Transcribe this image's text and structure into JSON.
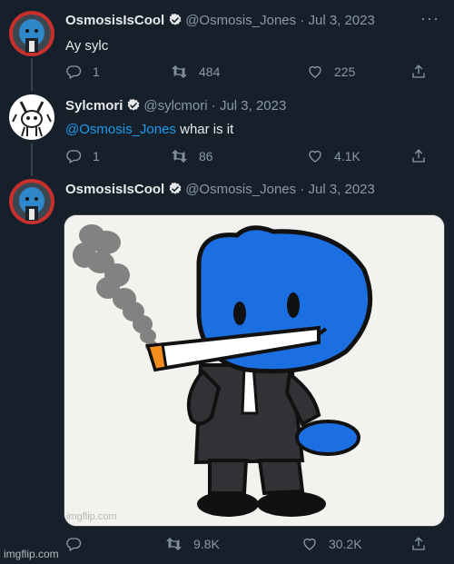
{
  "tweets": [
    {
      "display_name": "OsmosisIsCool",
      "handle": "@Osmosis_Jones",
      "date": "· Jul 3, 2023",
      "text": "Ay sylc",
      "replies": "1",
      "retweets": "484",
      "likes": "225"
    },
    {
      "display_name": "Sylcmori",
      "handle": "@sylcmori",
      "date": "· Jul 3, 2023",
      "mention": "@Osmosis_Jones",
      "text": " whar is it",
      "replies": "1",
      "retweets": "86",
      "likes": "4.1K"
    },
    {
      "display_name": "OsmosisIsCool",
      "handle": "@Osmosis_Jones",
      "date": "· Jul 3, 2023",
      "retweets": "9.8K",
      "likes": "30.2K",
      "media_watermark": "imgflip.com"
    }
  ],
  "more_icon": "···",
  "watermark": "imgflip.com",
  "colors": {
    "background": "#15202b",
    "text": "#e7e9ea",
    "muted": "#8b98a5",
    "accent": "#1d9bf0",
    "border": "#38444d"
  },
  "icons": [
    "reply-icon",
    "retweet-icon",
    "like-icon",
    "share-icon",
    "verified-icon",
    "more-icon"
  ]
}
